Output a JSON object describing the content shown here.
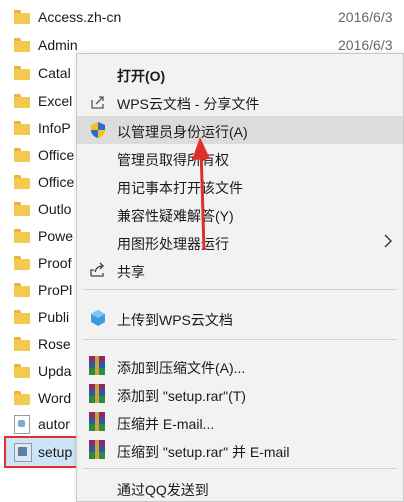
{
  "files": [
    {
      "name": "Access.zh-cn",
      "date": "2016/6/3",
      "kind": "folder"
    },
    {
      "name": "Admin",
      "date": "2016/6/3",
      "kind": "folder"
    },
    {
      "name": "Catal",
      "kind": "folder"
    },
    {
      "name": "Excel",
      "kind": "folder"
    },
    {
      "name": "InfoP",
      "kind": "folder"
    },
    {
      "name": "Office",
      "kind": "folder"
    },
    {
      "name": "Office",
      "kind": "folder"
    },
    {
      "name": "Outlo",
      "kind": "folder"
    },
    {
      "name": "Powe",
      "kind": "folder"
    },
    {
      "name": "Proof",
      "kind": "folder"
    },
    {
      "name": "ProPl",
      "kind": "folder"
    },
    {
      "name": "Publi",
      "kind": "folder"
    },
    {
      "name": "Rose",
      "kind": "folder"
    },
    {
      "name": "Upda",
      "kind": "folder"
    },
    {
      "name": "Word",
      "kind": "folder"
    },
    {
      "name": "autor",
      "kind": "file"
    },
    {
      "name": "setup",
      "kind": "setup"
    }
  ],
  "menu": {
    "open": "打开(O)",
    "wps_share": "WPS云文档 - 分享文件",
    "run_as_admin": "以管理员身份运行(A)",
    "take_ownership": "管理员取得所有权",
    "open_notepad": "用记事本打开该文件",
    "compat": "兼容性疑难解答(Y)",
    "open_image": "用图形处理器运行",
    "share": "共享",
    "upload_wps": "上传到WPS云文档",
    "add_archive": "添加到压缩文件(A)...",
    "add_setup_rar": "添加到 \"setup.rar\"(T)",
    "compress_email": "压缩并 E-mail...",
    "compress_setup_email": "压缩到 \"setup.rar\" 并 E-mail",
    "send_qq": "通过QQ发送到"
  },
  "colors": {
    "menu_bg": "#f2f2f2",
    "hover": "#dcdcdc",
    "highlight_border": "#e0302a",
    "selection": "#cce4f7",
    "arrow": "#e0302a"
  }
}
